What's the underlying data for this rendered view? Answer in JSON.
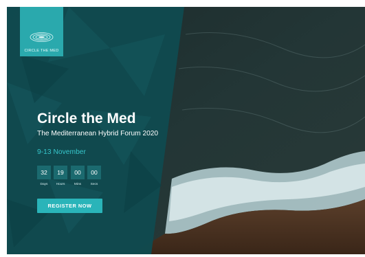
{
  "logo": {
    "text": "CIRCLE THE MED"
  },
  "hero": {
    "title": "Circle the Med",
    "subtitle": "The Mediterranean Hybrid Forum 2020",
    "dates": "9-13 November"
  },
  "countdown": [
    {
      "value": "32",
      "label": "Days"
    },
    {
      "value": "19",
      "label": "Hours"
    },
    {
      "value": "00",
      "label": "Mins"
    },
    {
      "value": "00",
      "label": "Secs"
    }
  ],
  "cta": {
    "label": "REGISTER NOW"
  },
  "colors": {
    "accent": "#2ab4b9",
    "panel": "#0f4a50",
    "countdown_box": "#1b6a6f",
    "date_text": "#36c6cb"
  }
}
